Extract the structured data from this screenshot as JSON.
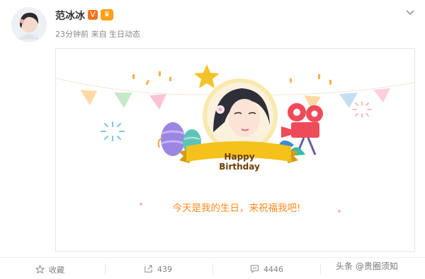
{
  "user": {
    "name": "范冰冰",
    "vip_badge": "V",
    "meta": "23分钟前 来自 生日动态"
  },
  "card": {
    "banner_text": "Happy Birthday",
    "wish_text": "今天是我的生日，来祝福我吧!"
  },
  "actions": {
    "favorite_label": "收藏",
    "share_count": "439",
    "comment_count": "4446"
  },
  "watermark": "头条 @贵圈须知",
  "colors": {
    "accent_orange": "#ff8a1f",
    "banner_yellow": "#f4c21b",
    "text_gray": "#808080"
  }
}
